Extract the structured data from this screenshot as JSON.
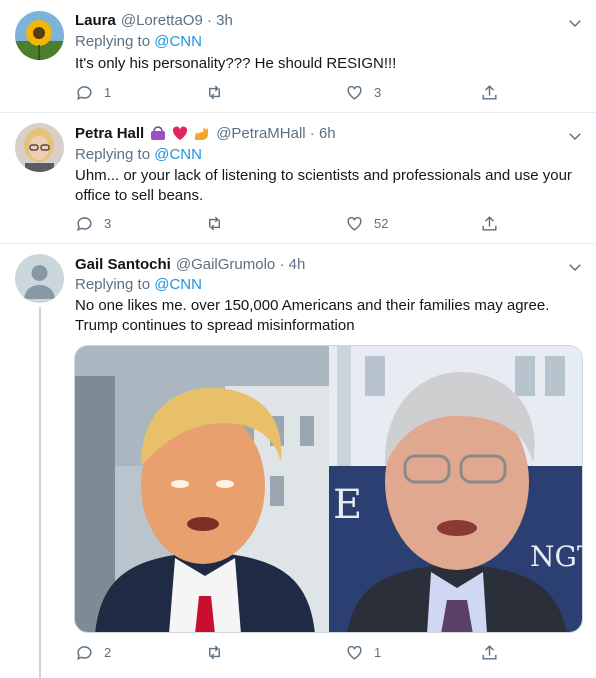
{
  "colors": {
    "accent": "#1b95e0",
    "muted": "#5b7083",
    "divider": "#e6ecf0",
    "text": "#0f1419"
  },
  "replying_label": "Replying to",
  "tweets": [
    {
      "name": "Laura",
      "handle": "@LorettaO9 · 3h",
      "mention": "@CNN",
      "text": "It's only his personality??? He should RESIGN!!!",
      "replies": "1",
      "retweets": "",
      "likes": "3",
      "avatar": "sunflower-avatar"
    },
    {
      "name": "Petra Hall",
      "emoji": [
        "purse-emoji",
        "red-heart-emoji",
        "cat-emoji"
      ],
      "handle": "@PetraMHall · 6h",
      "mention": "@CNN",
      "text": "Uhm... or your lack of listening to scientists and professionals and use your office to sell beans.",
      "replies": "3",
      "retweets": "",
      "likes": "52",
      "avatar": "woman-with-glasses-avatar"
    },
    {
      "name": "Gail Santochi",
      "handle": "@GailGrumolo · 4h",
      "mention": "@CNN",
      "text": "No one likes me.  over 150,000 Americans and their families may agree.   Trump continues to spread misinformation",
      "replies": "2",
      "retweets": "",
      "likes": "1",
      "avatar": "default-profile-avatar",
      "media": "side-by-side-photo-two-men"
    }
  ]
}
